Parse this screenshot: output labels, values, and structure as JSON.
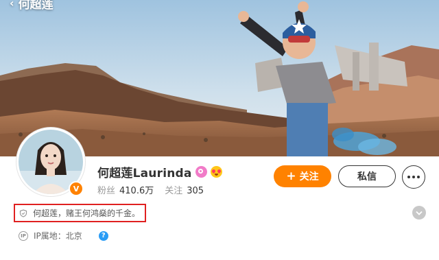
{
  "header": {
    "title": "何超莲",
    "back_icon": "chevron-left-icon"
  },
  "profile": {
    "name": "何超莲Laurinda",
    "verified_badge_text": "V",
    "level_badge": "pink-circle-badge-icon",
    "emoji_badge": "heart-eyes-emoji-icon",
    "followers_label": "粉丝",
    "followers_value": "410.6万",
    "following_label": "关注",
    "following_value": "305",
    "bio": "何超莲，赌王何鸿燊的千金。",
    "bio_icon": "shield-icon",
    "ip_icon_text": "IP",
    "ip_location": "IP属地：北京",
    "help_icon_text": "?"
  },
  "actions": {
    "follow_icon": "+",
    "follow_label": "关注",
    "message_label": "私信",
    "more_icon": "more-dots-icon",
    "expand_icon": "chevron-down-icon"
  },
  "colors": {
    "accent": "#ff8200",
    "highlight_border": "#e02020",
    "help_blue": "#2a9cf5",
    "level_pink": "#f17bc8"
  }
}
